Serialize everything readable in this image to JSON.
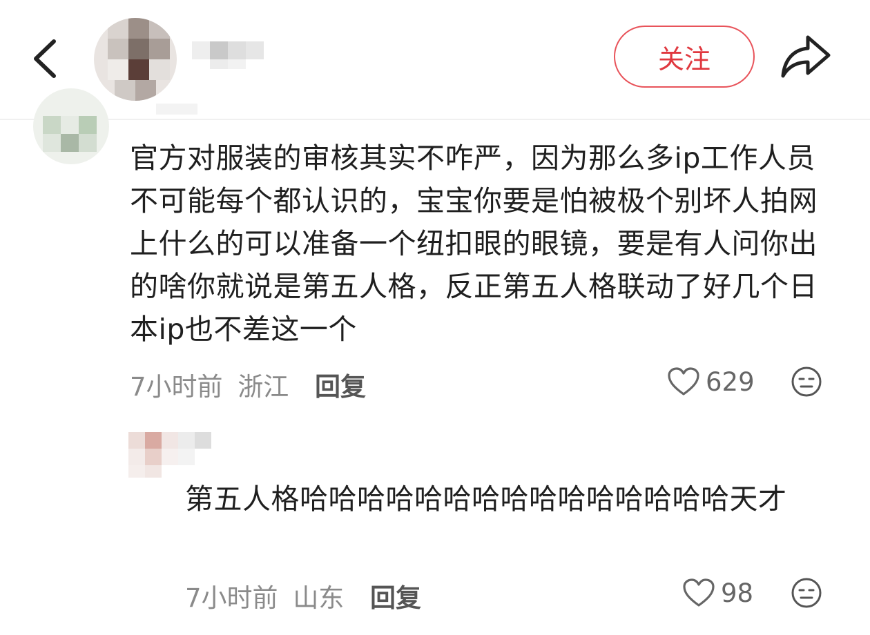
{
  "header": {
    "follow_label": "关注"
  },
  "comments": [
    {
      "text": "官方对服装的审核其实不咋严，因为那么多ip工作人员不可能每个都认识的，宝宝你要是怕被极个别坏人拍网上什么的可以准备一个纽扣眼的眼镜，要是有人问你出的啥你就说是第五人格，反正第五人格联动了好几个日本ip也不差这一个",
      "time": "7小时前",
      "location": "浙江",
      "reply_label": "回复",
      "likes": "629"
    },
    {
      "text": "第五人格哈哈哈哈哈哈哈哈哈哈哈哈哈哈哈天才",
      "time": "7小时前",
      "location": "山东",
      "reply_label": "回复",
      "likes": "98"
    }
  ],
  "icons": {
    "back": "chevron-left-icon",
    "share": "share-arrow-icon",
    "like": "heart-outline-icon",
    "emoji": "neutral-face-icon"
  },
  "colors": {
    "accent": "#e0383f",
    "meta": "#8a8a8a"
  }
}
